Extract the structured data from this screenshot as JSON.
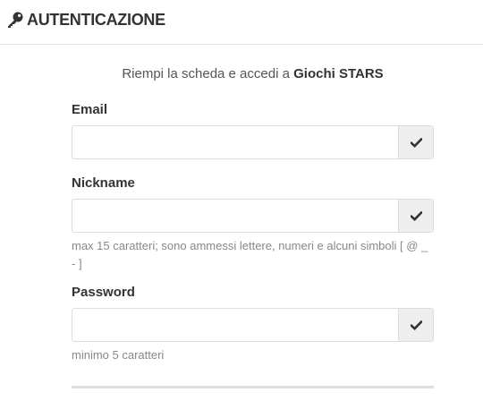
{
  "header": {
    "icon": "key-icon",
    "title": "AUTENTICAZIONE"
  },
  "intro": {
    "text": "Riempi la scheda e accedi a ",
    "brand": "Giochi STARS"
  },
  "fields": {
    "email": {
      "label": "Email",
      "value": "",
      "placeholder": "",
      "status_icon": "check-icon"
    },
    "nickname": {
      "label": "Nickname",
      "value": "",
      "placeholder": "",
      "status_icon": "check-icon",
      "help": "max 15 caratteri; sono ammessi lettere, numeri e alcuni simboli [ @ _ - ]"
    },
    "password": {
      "label": "Password",
      "value": "",
      "placeholder": "",
      "status_icon": "check-icon",
      "help": "minimo 5 caratteri"
    }
  },
  "colors": {
    "text": "#333333",
    "muted": "#888888",
    "border": "#dddddd",
    "addon_bg": "#eeeeee"
  }
}
